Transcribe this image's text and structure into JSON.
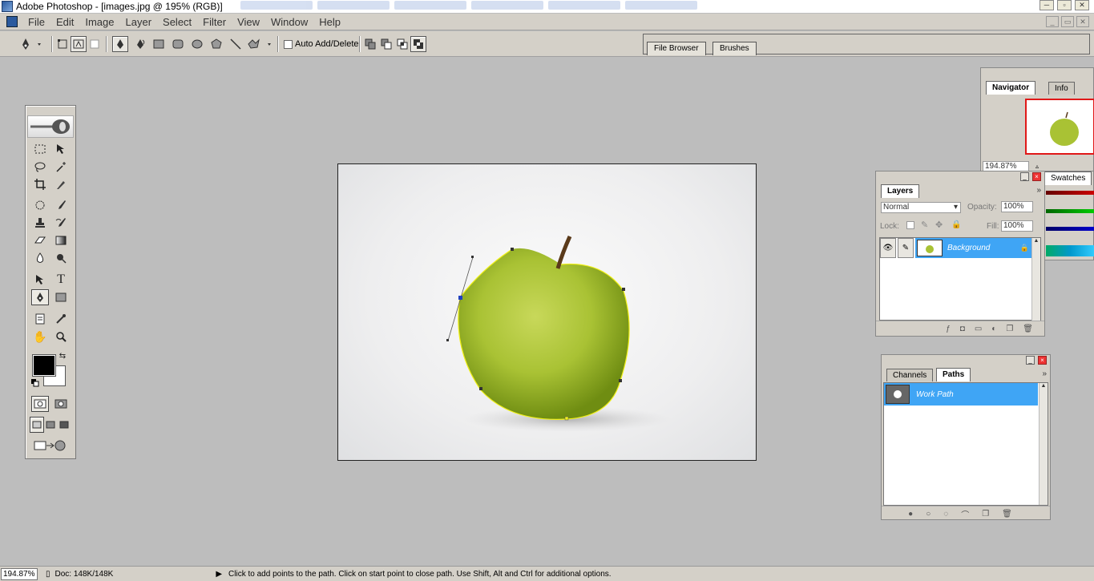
{
  "window": {
    "title": "Adobe Photoshop - [images.jpg @ 195% (RGB)]",
    "controls": [
      "─",
      "▫",
      "✕"
    ],
    "doc_controls": [
      "_",
      "▭",
      "✕"
    ]
  },
  "menu": [
    "File",
    "Edit",
    "Image",
    "Layer",
    "Select",
    "Filter",
    "View",
    "Window",
    "Help"
  ],
  "options": {
    "auto_add_delete_label": "Auto Add/Delete",
    "auto_add_delete_checked": false,
    "well_tabs": [
      "File Browser",
      "Brushes"
    ]
  },
  "navigator": {
    "tabs": [
      "Navigator",
      "Info"
    ],
    "zoom_value": "194.87%"
  },
  "swatches": {
    "tab_label": "Swatches"
  },
  "layers": {
    "tab_label": "Layers",
    "blend_mode": "Normal",
    "opacity_label": "Opacity:",
    "opacity_value": "100%",
    "lock_label": "Lock:",
    "fill_label": "Fill:",
    "fill_value": "100%",
    "items": [
      {
        "name": "Background",
        "visible": true,
        "locked": true,
        "selected": true
      }
    ]
  },
  "paths": {
    "tabs": [
      "Channels",
      "Paths"
    ],
    "items": [
      {
        "name": "Work Path",
        "selected": true
      }
    ]
  },
  "status": {
    "zoom": "194.87%",
    "doc_info": "Doc: 148K/148K",
    "hint": "Click to add points to the path.  Click on start point to close path.  Use Shift, Alt and Ctrl for additional options."
  },
  "colors": {
    "foreground": "#000000",
    "background": "#ffffff",
    "selection": "#3fa5f5",
    "apple": "#a9c234",
    "path_stroke": "#f0f018"
  }
}
